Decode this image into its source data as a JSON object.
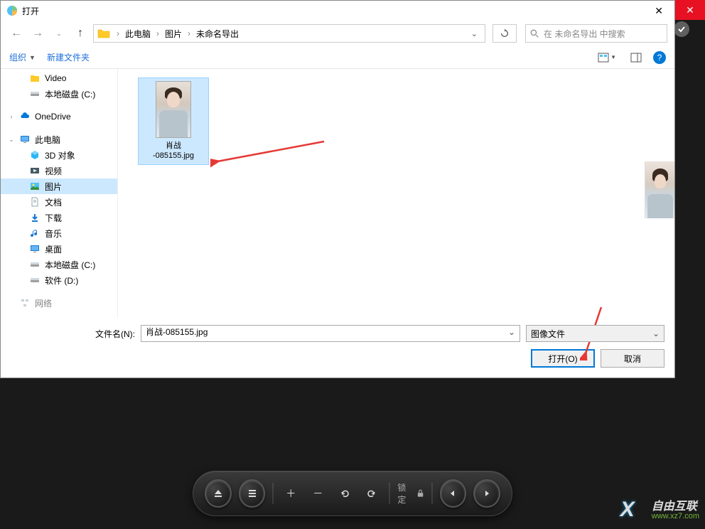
{
  "dialog": {
    "title": "打开",
    "breadcrumb": {
      "root": "此电脑",
      "folder1": "图片",
      "folder2": "未命名导出"
    },
    "search_placeholder": "在 未命名导出 中搜索",
    "toolbar": {
      "organize": "组织",
      "new_folder": "新建文件夹"
    },
    "sidebar": {
      "video": "Video",
      "local_c1": "本地磁盘 (C:)",
      "onedrive": "OneDrive",
      "this_pc": "此电脑",
      "objects3d": "3D 对象",
      "videos": "视频",
      "pictures": "图片",
      "documents": "文档",
      "downloads": "下载",
      "music": "音乐",
      "desktop": "桌面",
      "local_c2": "本地磁盘 (C:)",
      "software_d": "软件 (D:)",
      "network": "网络"
    },
    "file": {
      "name_line1": "肖战",
      "name_line2": "-085155.jpg"
    },
    "footer": {
      "filename_label": "文件名(N):",
      "filename_value": "肖战-085155.jpg",
      "filter": "图像文件",
      "open": "打开(O)",
      "cancel": "取消"
    }
  },
  "bottom_toolbar": {
    "lock": "锁定"
  },
  "watermark": {
    "brand": "自由互联",
    "url": "www.xz7.com"
  }
}
